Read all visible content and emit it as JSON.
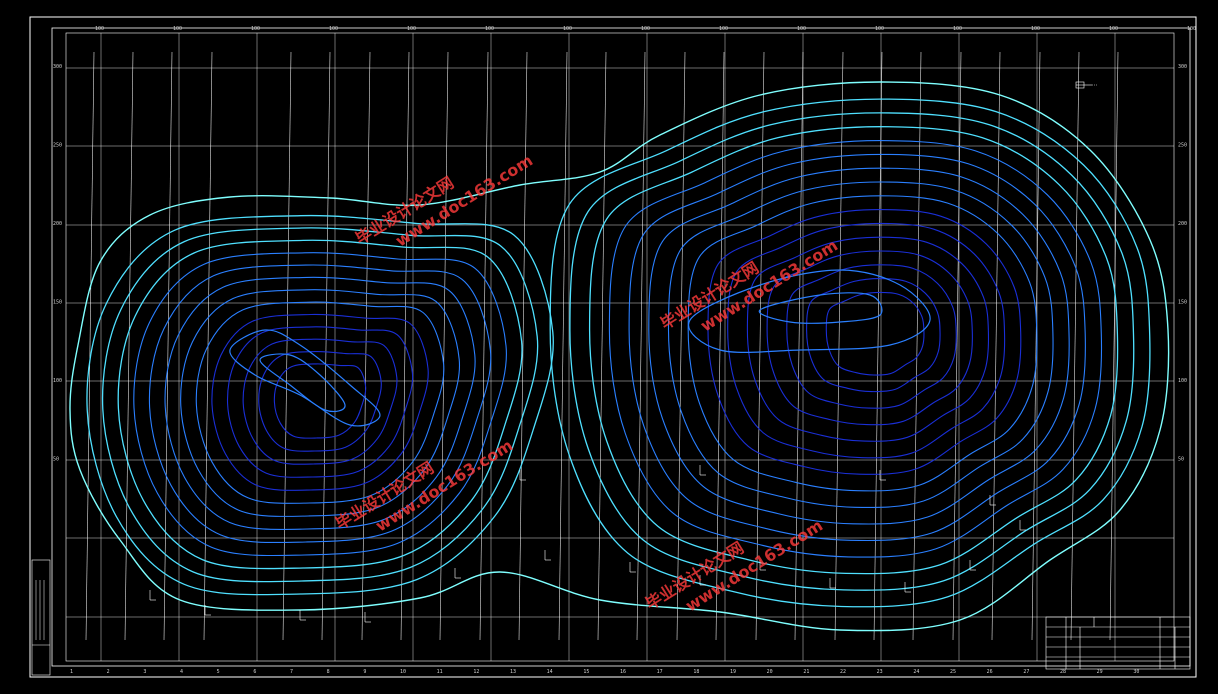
{
  "drawing": {
    "background": "#000000",
    "frame_color": "#ffffff",
    "grid_color": "#ffffff",
    "contour_colors": {
      "light": "#4fe0ff",
      "mid": "#2a7fff",
      "dark": "#1a2fd6",
      "outer": "#7fffff"
    },
    "hatch_color": "#ffffff"
  },
  "axes": {
    "bottom_ticks": [
      "1",
      "2",
      "3",
      "4",
      "5",
      "6",
      "7",
      "8",
      "9",
      "10",
      "11",
      "12",
      "13",
      "14",
      "15",
      "16",
      "17",
      "18",
      "19",
      "20",
      "21",
      "22",
      "23",
      "24",
      "25",
      "26",
      "27",
      "28",
      "29",
      "30"
    ],
    "top_ticks": [
      "100",
      "100",
      "100",
      "100",
      "100",
      "100",
      "100",
      "100",
      "100",
      "100",
      "100",
      "100",
      "100",
      "100",
      "100"
    ],
    "left_ticks": [
      "300",
      "250",
      "200",
      "150",
      "100",
      "50"
    ],
    "right_ticks": [
      "300",
      "250",
      "200",
      "150",
      "100",
      "50"
    ]
  },
  "legend_note": "",
  "watermark": {
    "label": "毕业设计论文网",
    "url": "www.doc163.com",
    "color": "#ff3b3b"
  },
  "title_block": {
    "rows": [
      "",
      "",
      "",
      "",
      ""
    ],
    "cells": [
      "",
      "",
      "",
      ""
    ]
  }
}
